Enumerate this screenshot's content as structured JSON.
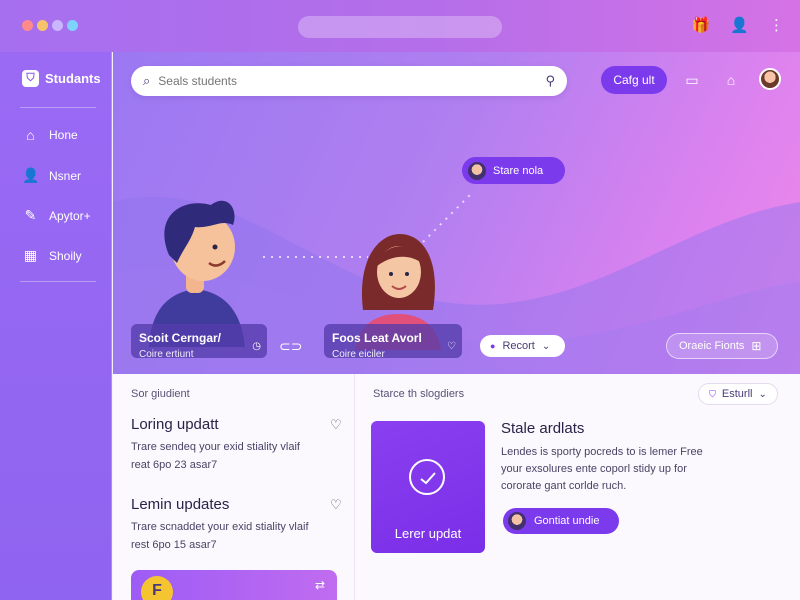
{
  "colors": {
    "accent": "#7c3aed",
    "sidebar": "#9a6af4",
    "hero_start": "#9b78f2",
    "hero_end": "#f08ae9"
  },
  "window": {
    "dot_colors": [
      "#ff8a8a",
      "#f7c36a",
      "#c9b6ff",
      "#7dd3fc"
    ]
  },
  "top_icons": [
    "gift-icon",
    "user-icon",
    "more-vertical-icon"
  ],
  "sidebar": {
    "brand": "Studants",
    "items": [
      {
        "label": "Hone",
        "icon": "home-icon"
      },
      {
        "label": "Nsner",
        "icon": "user-icon"
      },
      {
        "label": "Apytor+",
        "icon": "pencil-icon"
      },
      {
        "label": "Shoily",
        "icon": "grid-icon"
      }
    ]
  },
  "header": {
    "search_placeholder": "Seals students",
    "action_button": "Cafg ult",
    "icons": [
      "inbox-icon",
      "bag-icon",
      "avatar"
    ]
  },
  "hero": {
    "share_pill": "Stare nola",
    "record_pill": "Recort",
    "create_pill": "Oraeic Fionts",
    "student1": {
      "name": "Scoit Cerngar/",
      "sub": "Coire ertiunt"
    },
    "student2": {
      "name": "Foos Leat Avorl",
      "sub": "Coire eiciler"
    }
  },
  "lower": {
    "left_label": "Sor giudient",
    "updates": [
      {
        "title": "Loring updatt",
        "line1": "Trare sendeq your exid stiality vlaif",
        "line2": "reat 6po 23 asar7"
      },
      {
        "title": "Lemin updates",
        "line1": "Trare scnaddet your exid stiality vlaif",
        "line2": "rest 6po 15 asar7"
      }
    ],
    "right_label": "Starce th slogdiers",
    "filter": "Esturll",
    "tile_label": "Lerer updat",
    "feature_title": "Stale ardlats",
    "feature_lines": [
      "Lendes is sporty pocreds to is lemer Free",
      "your exsolures ente coporl stidy up for",
      "cororate gant corlde ruch."
    ],
    "feature_button": "Gontiat undie"
  }
}
